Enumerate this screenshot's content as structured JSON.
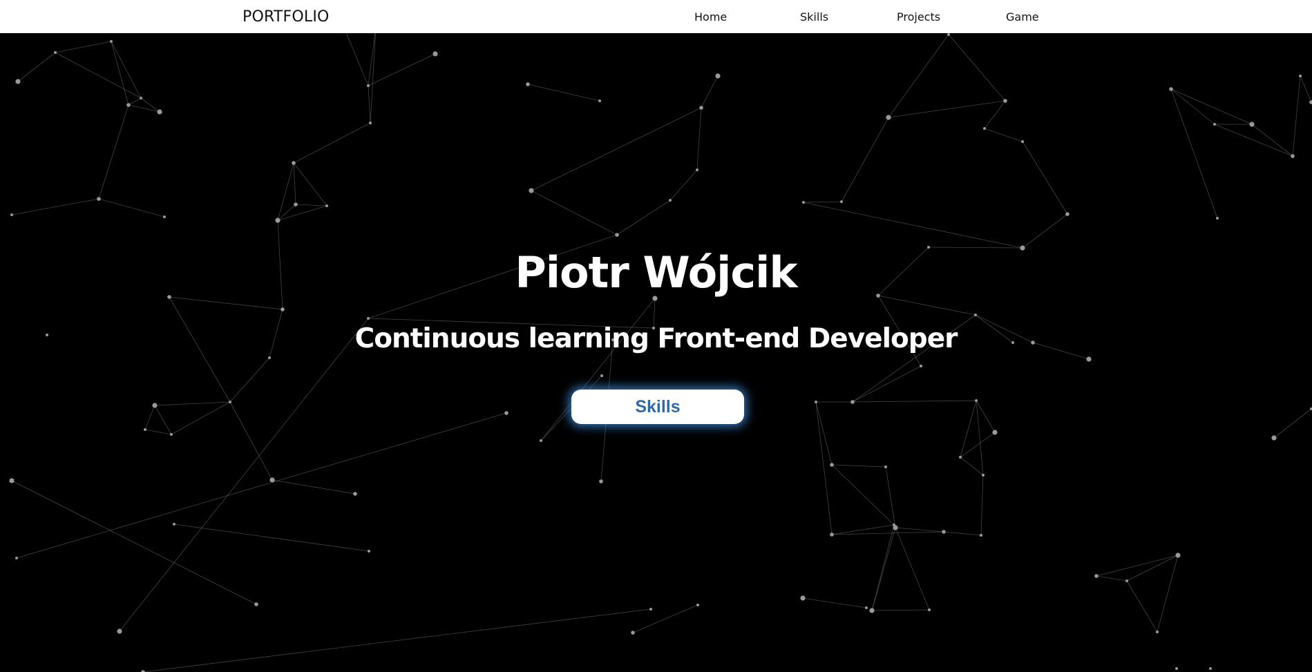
{
  "navbar": {
    "brand": "PORTFOLIO",
    "links": [
      {
        "label": "Home"
      },
      {
        "label": "Skills"
      },
      {
        "label": "Projects"
      },
      {
        "label": "Game"
      }
    ]
  },
  "hero": {
    "title": "Piotr Wójcik",
    "subtitle": "Continuous learning Front-end Developer",
    "button_label": "Skills"
  },
  "colors": {
    "background": "#000000",
    "navbar": "#ffffff",
    "text": "#ffffff",
    "button_text": "#2f6aa8",
    "button_glow": "#4296eb",
    "particle": "#9a9a9a"
  }
}
